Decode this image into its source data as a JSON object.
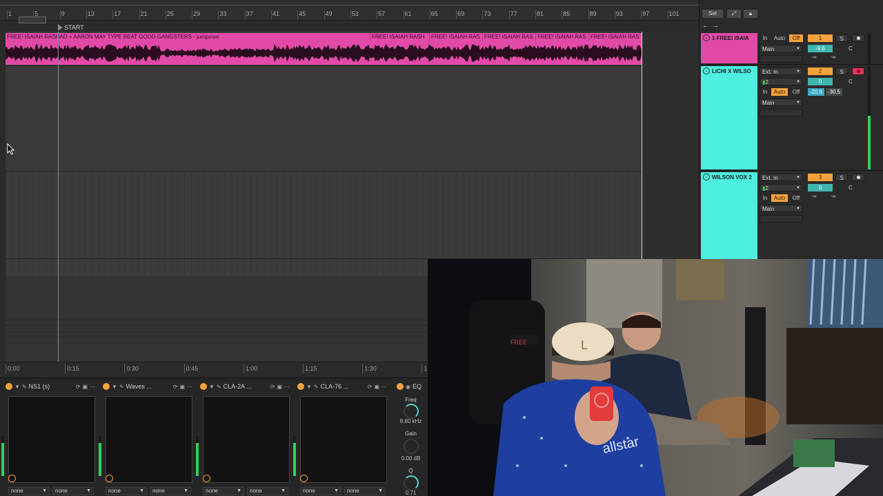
{
  "ruler": {
    "bars": [
      "1",
      "5",
      "9",
      "13",
      "17",
      "21",
      "25",
      "29",
      "33",
      "37",
      "41",
      "45",
      "49",
      "53",
      "57",
      "61",
      "65",
      "69",
      "73",
      "77",
      "81",
      "85",
      "89",
      "93",
      "97",
      "101"
    ],
    "start_label": "START"
  },
  "clip": {
    "segments": [
      "FREE! ISAIAH RASHAD + AARON MAY TYPE BEAT GOOD GANGSTERS - jumpmvn",
      "FREE! ISAIAH RASH",
      "FREE! ISAIAH RAS",
      "FREE! ISAIAH RAS",
      "FREE! ISAIAH RAS",
      "FREE! ISAIAH RAS"
    ],
    "color": "#e24aa8"
  },
  "time_ruler": [
    "0:00",
    "0:15",
    "0:30",
    "0:45",
    "1:00",
    "1:15",
    "1:30",
    "1:"
  ],
  "devices": [
    {
      "name": "NS1 (s)",
      "sel1": "none",
      "sel2": "none"
    },
    {
      "name": "Waves ...",
      "sel1": "none",
      "sel2": "none"
    },
    {
      "name": "CLA-2A ...",
      "sel1": "none",
      "sel2": "none"
    },
    {
      "name": "CLA-76 ...",
      "sel1": "none",
      "sel2": "none"
    }
  ],
  "eq": {
    "title": "EQ",
    "freq_label": "Freq",
    "freq_value": "8.80 kHz",
    "gain_label": "Gain",
    "gain_value": "0.00 dB",
    "q_label": "Q",
    "q_value": "0.71"
  },
  "mixer": {
    "set_label": "Set",
    "tracks": [
      {
        "name": "1 FREEI ISAIA",
        "color": "#e24aa8",
        "input": "Main",
        "in": "In",
        "auto": "Auto",
        "off": "Off",
        "number": "1",
        "solo": "S",
        "volume": "-9.6",
        "pan": "C",
        "inf1": "-∞",
        "inf2": "-∞"
      },
      {
        "name": "LICHI X WILSO",
        "color": "#4cefe0",
        "source": "Ext. In",
        "channel": "2",
        "in": "In",
        "auto": "Auto",
        "off": "Off",
        "output": "Main",
        "number": "2",
        "solo": "S",
        "volume": "0",
        "pan": "C",
        "peak1": "-20.6",
        "peak2": "-30.5"
      },
      {
        "name": "WILSON VOX 2",
        "color": "#4cefe0",
        "source": "Ext. In",
        "channel": "2",
        "in": "In",
        "auto": "Auto",
        "off": "Off",
        "output": "Main",
        "number": "3",
        "solo": "S",
        "volume": "0",
        "pan": "C",
        "inf1": "-∞",
        "inf2": "-∞"
      }
    ]
  },
  "webcam": {
    "hat_logo": "L",
    "shirt_text": "allstar",
    "screen_text": "FREE"
  }
}
